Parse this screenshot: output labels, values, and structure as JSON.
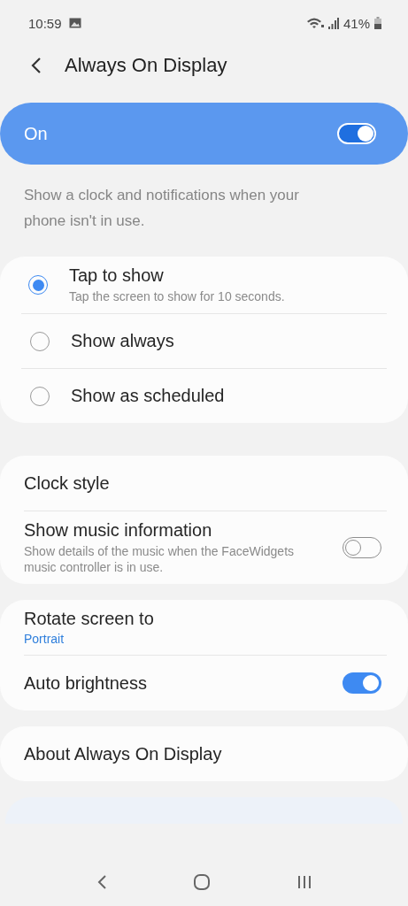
{
  "status_bar": {
    "time": "10:59",
    "battery": "41%"
  },
  "header": {
    "title": "Always On Display"
  },
  "master_switch": {
    "label": "On",
    "on": true
  },
  "description": "Show a clock and notifications when your phone isn't in use.",
  "display_modes": [
    {
      "label": "Tap to show",
      "summary": "Tap the screen to show for 10 seconds.",
      "selected": true
    },
    {
      "label": "Show always",
      "selected": false
    },
    {
      "label": "Show as scheduled",
      "selected": false
    }
  ],
  "sections": [
    [
      {
        "kind": "item",
        "title": "Clock style"
      },
      {
        "kind": "switch",
        "title": "Show music information",
        "summary": "Show details of the music when the FaceWidgets music controller is in use.",
        "on": false
      }
    ],
    [
      {
        "kind": "item",
        "title": "Rotate screen to",
        "value": "Portrait"
      },
      {
        "kind": "switch",
        "title": "Auto brightness",
        "on": true
      }
    ],
    [
      {
        "kind": "item",
        "title": "About Always On Display"
      }
    ]
  ]
}
